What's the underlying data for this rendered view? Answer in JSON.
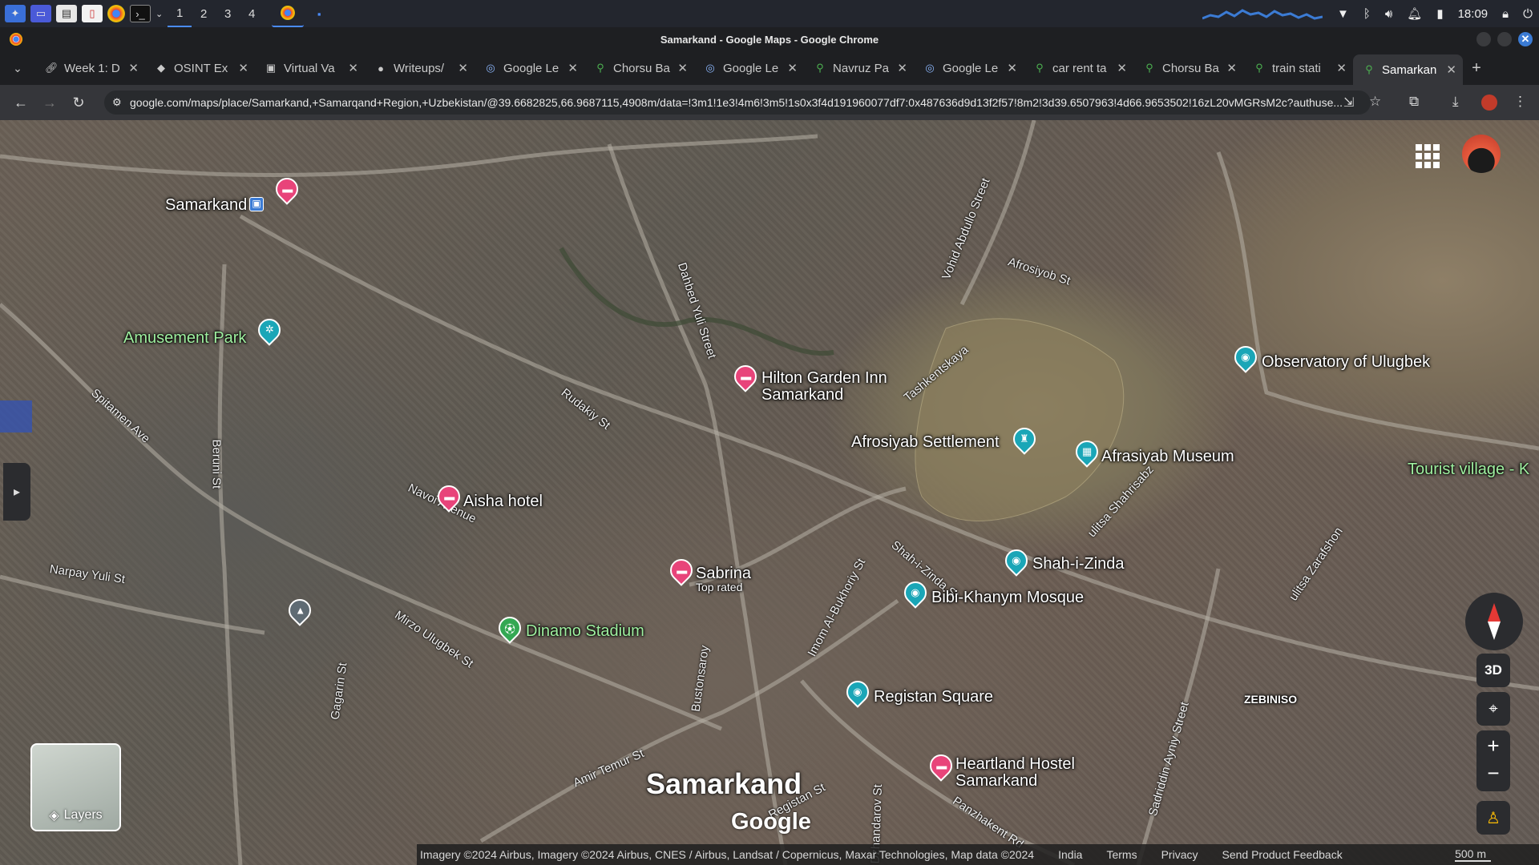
{
  "taskbar": {
    "workspaces": [
      "1",
      "2",
      "3",
      "4"
    ],
    "active_workspace": "1",
    "clock": "18:09"
  },
  "window": {
    "title": "Samarkand - Google Maps - Google Chrome"
  },
  "tabs": [
    {
      "icon": "link-icon",
      "label": "Week 1: D"
    },
    {
      "icon": "osint-icon",
      "label": "OSINT Ex"
    },
    {
      "icon": "box-icon",
      "label": "Virtual Va"
    },
    {
      "icon": "github-icon",
      "label": "Writeups/"
    },
    {
      "icon": "google-lens-icon",
      "label": "Google Le"
    },
    {
      "icon": "map-pin-icon",
      "label": "Chorsu Ba"
    },
    {
      "icon": "google-lens-icon",
      "label": "Google Le"
    },
    {
      "icon": "map-pin-icon",
      "label": "Navruz Pa"
    },
    {
      "icon": "google-lens-icon",
      "label": "Google Le"
    },
    {
      "icon": "map-pin-icon",
      "label": "car rent ta"
    },
    {
      "icon": "map-pin-icon",
      "label": "Chorsu Ba"
    },
    {
      "icon": "map-pin-icon",
      "label": "train stati"
    },
    {
      "icon": "map-pin-icon",
      "label": "Samarkan",
      "active": true
    }
  ],
  "toolbar": {
    "url": "google.com/maps/place/Samarkand,+Samarqand+Region,+Uzbekistan/@39.6682825,66.9687115,4908m/data=!3m1!1e3!4m6!3m5!1s0x3f4d191960077df7:0x487636d9d13f2f57!8m2!3d39.6507963!4d66.9653502!16zL20vMGRsM2c?authuse..."
  },
  "map": {
    "places": [
      {
        "label": "Samarkand",
        "type": "train"
      },
      {
        "label": "Amusement Park",
        "type": "park"
      },
      {
        "label": "Hilton Garden Inn Samarkand",
        "type": "hotel"
      },
      {
        "label": "Afrosiyab Settlement",
        "type": "landmark"
      },
      {
        "label": "Afrasiyab Museum",
        "type": "museum"
      },
      {
        "label": "Observatory of Ulugbek",
        "type": "museum"
      },
      {
        "label": "Tourist village - K",
        "type": "area"
      },
      {
        "label": "Aisha hotel",
        "type": "hotel"
      },
      {
        "label": "Sabrina",
        "sub": "Top rated",
        "type": "hotel"
      },
      {
        "label": "Dinamo Stadium",
        "type": "stadium"
      },
      {
        "label": "Shah-i-Zinda",
        "type": "museum"
      },
      {
        "label": "Bibi-Khanym Mosque",
        "type": "museum"
      },
      {
        "label": "Registan Square",
        "type": "museum"
      },
      {
        "label": "Heartland Hostel Samarkand",
        "type": "hotel"
      }
    ],
    "streets": [
      "Dahbed Yuli Street",
      "Vohid Abdullo Street",
      "Afrosiyob St",
      "Rudakiy St",
      "Spitamen Ave",
      "Beruni St",
      "Navoi Avenue",
      "Narpay Yuli St",
      "Mirzo Ulugbek St",
      "Gagarin St",
      "Bustonsaroy",
      "Imom Al-Bukhoriy St",
      "Shah-i-Zinda St",
      "Amir Temur St",
      "Registan St",
      "Panzhakent Rd",
      "Sadriddin Ayniy Street",
      "Dzhandarov St",
      "Tashkentskaya",
      "ulitsa Zarafshon",
      "ulitsa Shahrisabz"
    ],
    "district": "ZEBINISO",
    "city": "Samarkand",
    "logo": "Google",
    "layers_label": "Layers",
    "btn_3d": "3D",
    "attribution": {
      "imagery": "Imagery ©2024 Airbus, Imagery ©2024 Airbus, CNES / Airbus, Landsat / Copernicus, Maxar Technologies, Map data ©2024",
      "country": "India",
      "terms": "Terms",
      "privacy": "Privacy",
      "feedback": "Send Product Feedback",
      "scale": "500 m"
    }
  },
  "colors": {
    "hotel_pin": "#e8447a",
    "museum_pin": "#1aa6b7",
    "park_pin": "#34a853",
    "accent": "#4a8cff"
  }
}
